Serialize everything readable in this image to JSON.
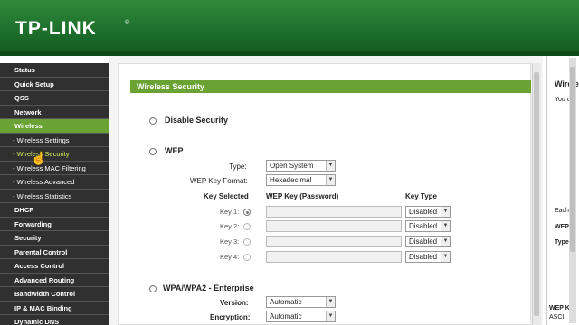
{
  "header": {
    "logo": "TP-LINK",
    "logo_mark": "®"
  },
  "sidebar": {
    "items": [
      {
        "label": "Status",
        "type": "main"
      },
      {
        "label": "Quick Setup",
        "type": "main"
      },
      {
        "label": "QSS",
        "type": "main"
      },
      {
        "label": "Network",
        "type": "main"
      },
      {
        "label": "Wireless",
        "type": "active"
      },
      {
        "label": "- Wireless Settings",
        "type": "sub"
      },
      {
        "label": "- Wireless Security",
        "type": "current"
      },
      {
        "label": "- Wireless MAC Filtering",
        "type": "sub"
      },
      {
        "label": "- Wireless Advanced",
        "type": "sub"
      },
      {
        "label": "- Wireless Statistics",
        "type": "sub"
      },
      {
        "label": "DHCP",
        "type": "main"
      },
      {
        "label": "Forwarding",
        "type": "main"
      },
      {
        "label": "Security",
        "type": "main"
      },
      {
        "label": "Parental Control",
        "type": "main"
      },
      {
        "label": "Access Control",
        "type": "main"
      },
      {
        "label": "Advanced Routing",
        "type": "main"
      },
      {
        "label": "Bandwidth Control",
        "type": "main"
      },
      {
        "label": "IP & MAC Binding",
        "type": "main"
      },
      {
        "label": "Dynamic DNS",
        "type": "main"
      }
    ]
  },
  "main": {
    "title": "Wireless Security",
    "disable_security": "Disable Security",
    "wep": {
      "label": "WEP",
      "type_label": "Type:",
      "type_value": "Open System",
      "format_label": "WEP Key Format:",
      "format_value": "Hexadecimal",
      "col_key_selected": "Key Selected",
      "col_wep_key": "WEP Key (Password)",
      "col_key_type": "Key Type",
      "keys": [
        {
          "label": "Key 1:",
          "type": "Disabled",
          "selected": true
        },
        {
          "label": "Key 2:",
          "type": "Disabled",
          "selected": false
        },
        {
          "label": "Key 3:",
          "type": "Disabled",
          "selected": false
        },
        {
          "label": "Key 4:",
          "type": "Disabled",
          "selected": false
        }
      ]
    },
    "wpa": {
      "label": "WPA/WPA2 - Enterprise",
      "version_label": "Version:",
      "version_value": "Automatic",
      "encryption_label": "Encryption:",
      "encryption_value": "Automatic"
    }
  },
  "help": {
    "title": "Wirele",
    "line1": "You ca",
    "line2": "Each s",
    "line3": "WEP",
    "line4": "Type - ",
    "line5": "WEP K",
    "line6": "ASCII"
  },
  "colors": {
    "brand_green": "#1e6f2c",
    "accent_green": "#6aa334",
    "sidebar_bg": "#303030",
    "submenu_current": "#d7ec5a"
  }
}
